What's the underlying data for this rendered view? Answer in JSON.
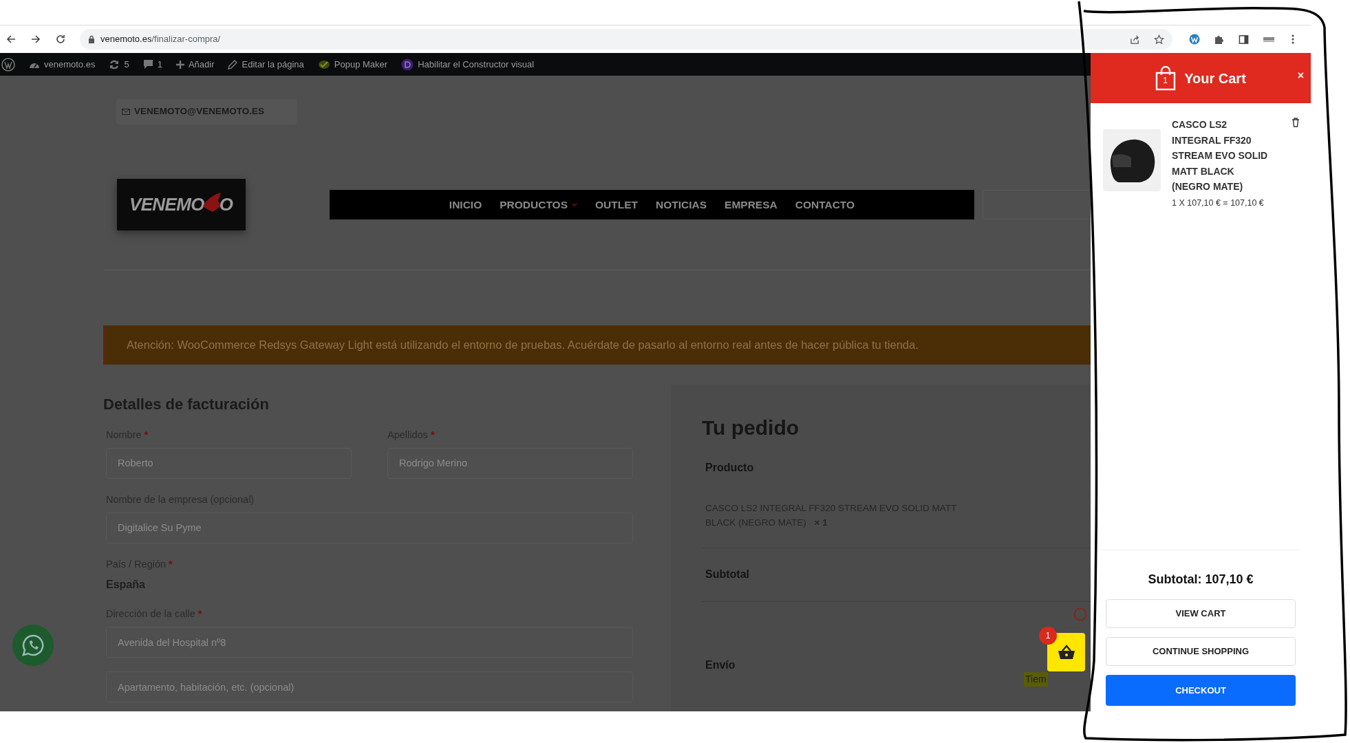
{
  "browser": {
    "url_domain": "venemoto.es",
    "url_path": "/finalizar-compra/"
  },
  "admin_bar": {
    "items": [
      {
        "kind": "wp-logo"
      },
      {
        "kind": "dashboard",
        "label": "venemoto.es"
      },
      {
        "kind": "updates",
        "label": "5"
      },
      {
        "kind": "comments",
        "label": "1"
      },
      {
        "kind": "add",
        "label": "Añadir"
      },
      {
        "kind": "edit",
        "label": "Editar la página"
      },
      {
        "kind": "popup",
        "label": "Popup Maker"
      },
      {
        "kind": "builder",
        "label": "Habilitar el Constructor visual"
      }
    ]
  },
  "header": {
    "email": "VENEMOTO@VENEMOTO.ES",
    "logo": {
      "left": "VENEMO",
      "right": "O"
    },
    "nav": [
      {
        "label": "INICIO",
        "has_dropdown": false
      },
      {
        "label": "PRODUCTOS",
        "has_dropdown": true
      },
      {
        "label": "OUTLET",
        "has_dropdown": false
      },
      {
        "label": "NOTICIAS",
        "has_dropdown": false
      },
      {
        "label": "EMPRESA",
        "has_dropdown": false
      },
      {
        "label": "CONTACTO",
        "has_dropdown": false
      }
    ]
  },
  "notice": "Atención: WooCommerce Redsys Gateway Light está utilizando el entorno de pruebas. Acuérdate de pasarlo al entorno real antes de hacer pública tu tienda.",
  "billing": {
    "title": "Detalles de facturación",
    "rows": [
      [
        {
          "kind": "input",
          "label": "Nombre",
          "required_mark": "*",
          "value": "Roberto"
        },
        {
          "kind": "input",
          "label": "Apellidos",
          "required_mark": "*",
          "value": "Rodrigo Merino"
        }
      ],
      [
        {
          "kind": "input",
          "label": "Nombre de la empresa (opcional)",
          "value": "Digitalice Su Pyme"
        }
      ],
      [
        {
          "kind": "static",
          "label": "País / Región",
          "required_mark": "*",
          "value": "España"
        }
      ],
      [
        {
          "kind": "input",
          "label": "Dirección de la calle",
          "required_mark": "*",
          "value": "Avenida del Hospital nº8"
        }
      ],
      [
        {
          "kind": "input",
          "placeholder": "Apartamento, habitación, etc. (opcional)"
        }
      ]
    ]
  },
  "order": {
    "title": "Tu pedido",
    "product_heading": "Producto",
    "product": "CASCO LS2 INTEGRAL FF320 STREAM EVO SOLID MATT BLACK (NEGRO MATE)",
    "quantity": "× 1",
    "subtotal_label": "Subtotal",
    "shipping_label": "Envío",
    "shipping_text": "Tiem"
  },
  "floating_cart": {
    "count": "1"
  },
  "cart": {
    "title": "Your Cart",
    "badge": "1",
    "close": "×",
    "items": [
      {
        "name": "CASCO LS2 INTEGRAL FF320 STREAM EVO SOLID MATT BLACK (NEGRO MATE)",
        "price_line": "1 X 107,10 € = 107,10 €"
      }
    ],
    "subtotal": "Subtotal: 107,10 €",
    "buttons": [
      {
        "label": "VIEW CART",
        "kind": "outline"
      },
      {
        "label": "CONTINUE SHOPPING",
        "kind": "outline"
      },
      {
        "label": "CHECKOUT",
        "kind": "primary"
      }
    ]
  }
}
